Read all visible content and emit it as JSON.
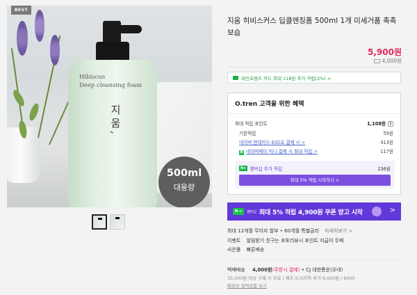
{
  "gallery": {
    "badge": "BEST",
    "bottle_text_1": "Hibiscus",
    "bottle_text_2": "Deep cleansing foam",
    "bottle_hangul": "지움,",
    "volume_badge": {
      "size": "500ml",
      "label": "대용량"
    },
    "thumbnail_count": 2
  },
  "product": {
    "title": "지움 히비스커스 딥클렌징폼 500ml 1개 미세거품 촉촉 보습",
    "price": "5,900원",
    "delivery_price": "4,000원"
  },
  "card_offer": "라인프렌즈 카드 최대 118원 추가 적립(2%) >",
  "benefits": {
    "title": "O.tren 고객을 위한 혜택",
    "max_points_label": "최대 적립 포인트",
    "max_points_value": "1,108원",
    "rows": [
      {
        "label": "기본적립",
        "value": "59원"
      },
      {
        "label": "네이버 현대카드 Ed2로 결제 시 >",
        "value": "413원"
      },
      {
        "label": "네이버페이 머니 결제 시 최대 적립 >",
        "value": "117원"
      }
    ],
    "membership_label": "멤버십 추가 적립",
    "membership_value": "236원",
    "membership_button": "최대 5% 적립 시작하기 >"
  },
  "promo_banner": {
    "tag": "N +",
    "tag2": "멤버십",
    "text": "최대 5% 적립 4,900원 쿠폰 받고 시작",
    "arrow": ">"
  },
  "info_lines": {
    "installment": "최대 12개월 무이자 할부 • 60개월 특별금리",
    "installment_more": "자세히보기 >",
    "event_label": "이벤트",
    "event_text": "알림받기 친구는 포토리뷰시 포인트 지급이 두배",
    "gift_label": "사은품",
    "gift_text": "빠른배송"
  },
  "shipping": {
    "label": "택배배송",
    "price": "4,000원",
    "prepaid": "(주문시 결제)",
    "carrier": "• CJ 대한통운(오네)",
    "condition": "35,000원 이상 구매 시 무료 / 제주,도서지역 추가 6,000원 / 6000",
    "link": "배송비 절약상품 보기"
  },
  "colors": {
    "accent_price": "#e2285a",
    "membership_purple": "#7d4fe0",
    "promo_purple": "#6238d9",
    "naver_green": "#19b34a"
  }
}
